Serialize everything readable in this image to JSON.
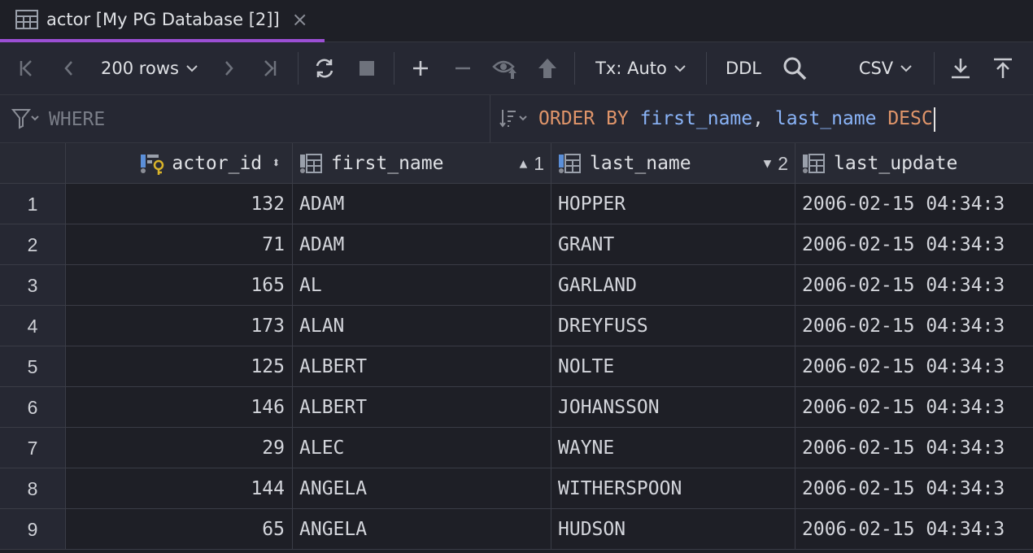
{
  "tab": {
    "title": "actor [My PG Database [2]]",
    "close": "×"
  },
  "toolbar": {
    "rows_label": "200 rows",
    "tx_label": "Tx: Auto",
    "ddl_label": "DDL",
    "export_format": "CSV"
  },
  "filter": {
    "where_placeholder": "WHERE",
    "order_by": {
      "kw1": "ORDER BY",
      "col1": "first_name",
      "comma": ",",
      "col2": "last_name",
      "kw2": "DESC"
    }
  },
  "columns": [
    {
      "name": "actor_id",
      "sort_indicator": "⬍",
      "sort_order": ""
    },
    {
      "name": "first_name",
      "sort_indicator": "▲",
      "sort_order": "1"
    },
    {
      "name": "last_name",
      "sort_indicator": "▼",
      "sort_order": "2"
    },
    {
      "name": "last_update",
      "sort_indicator": "",
      "sort_order": ""
    }
  ],
  "rows": [
    {
      "n": "1",
      "actor_id": "132",
      "first_name": "ADAM",
      "last_name": "HOPPER",
      "last_update": "2006-02-15 04:34:3"
    },
    {
      "n": "2",
      "actor_id": "71",
      "first_name": "ADAM",
      "last_name": "GRANT",
      "last_update": "2006-02-15 04:34:3"
    },
    {
      "n": "3",
      "actor_id": "165",
      "first_name": "AL",
      "last_name": "GARLAND",
      "last_update": "2006-02-15 04:34:3"
    },
    {
      "n": "4",
      "actor_id": "173",
      "first_name": "ALAN",
      "last_name": "DREYFUSS",
      "last_update": "2006-02-15 04:34:3"
    },
    {
      "n": "5",
      "actor_id": "125",
      "first_name": "ALBERT",
      "last_name": "NOLTE",
      "last_update": "2006-02-15 04:34:3"
    },
    {
      "n": "6",
      "actor_id": "146",
      "first_name": "ALBERT",
      "last_name": "JOHANSSON",
      "last_update": "2006-02-15 04:34:3"
    },
    {
      "n": "7",
      "actor_id": "29",
      "first_name": "ALEC",
      "last_name": "WAYNE",
      "last_update": "2006-02-15 04:34:3"
    },
    {
      "n": "8",
      "actor_id": "144",
      "first_name": "ANGELA",
      "last_name": "WITHERSPOON",
      "last_update": "2006-02-15 04:34:3"
    },
    {
      "n": "9",
      "actor_id": "65",
      "first_name": "ANGELA",
      "last_name": "HUDSON",
      "last_update": "2006-02-15 04:34:3"
    }
  ],
  "colors": {
    "accent": "#9b4fd4",
    "keyword": "#e0956a",
    "identifier": "#8ab4f8",
    "key_icon": "#d8b32a",
    "column_icon": "#5b8fd9"
  },
  "icons": [
    "table-icon",
    "first-page-icon",
    "prev-page-icon",
    "chevron-down-icon",
    "next-page-icon",
    "last-page-icon",
    "refresh-icon",
    "stop-icon",
    "add-row-icon",
    "delete-row-icon",
    "preview-icon",
    "submit-icon",
    "search-icon",
    "download-icon",
    "upload-icon",
    "filter-icon",
    "sort-icon",
    "primary-key-icon",
    "column-icon"
  ]
}
